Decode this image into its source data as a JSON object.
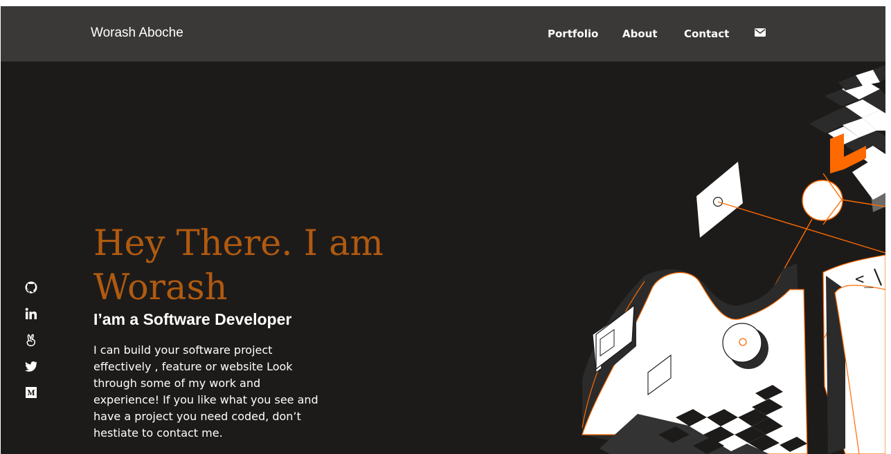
{
  "header": {
    "brand": "Worash Aboche",
    "nav": [
      "Portfolio",
      "About",
      "Contact"
    ],
    "mail_icon": "envelope-icon"
  },
  "social": {
    "icons": [
      "github-icon",
      "linkedin-icon",
      "angellist-icon",
      "twitter-icon",
      "medium-icon"
    ]
  },
  "hero": {
    "title_line1": "Hey There. I am",
    "title_line2": "Worash",
    "subtitle": "I’am a Software Developer",
    "description": "I can build your software project effectively , feature or website Look through some of my work and experience! If you like what you see and have a project you need coded, don’t hestiate to contact me."
  },
  "illustration": {
    "code_glyph": "<_",
    "icon": "isometric-developer-illustration"
  },
  "colors": {
    "accent": "#b05a10",
    "orange": "#ff6a00",
    "background": "#1d1b1a",
    "navbar": "#3a3938",
    "text": "#ffffff"
  }
}
